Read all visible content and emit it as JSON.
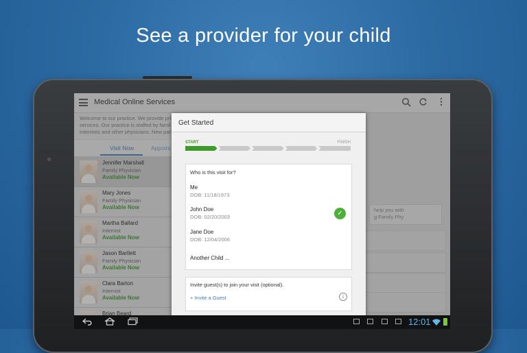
{
  "headline": "See a provider for your child",
  "app": {
    "title": "Medical Online Services",
    "intro_line1": "Welcome to our practice. We provide pri",
    "intro_line2": "services. Our practice is staffed by famil",
    "intro_line3": "internists and other physicians. New pat",
    "icons": [
      "menu-icon",
      "search-icon",
      "refresh-icon",
      "overflow-icon"
    ]
  },
  "tabs": {
    "visit_now": "Visit Now",
    "appointments": "Appoint"
  },
  "providers": [
    {
      "name": "Jennifer Marshall",
      "title": "Family Physician",
      "status": "Available Now"
    },
    {
      "name": "Mary Jones",
      "title": "Family Physician",
      "status": "Available Now"
    },
    {
      "name": "Martha Ballard",
      "title": "Internist",
      "status": "Available Now"
    },
    {
      "name": "Jason Bartlett",
      "title": "Family Physician",
      "status": "Available Now"
    },
    {
      "name": "Clara Barton",
      "title": "Internist",
      "status": "Available Now"
    },
    {
      "name": "Brian Beard",
      "title": "",
      "status": ""
    }
  ],
  "background_help": {
    "line1": "help you with",
    "line2": "g Family Phy"
  },
  "dialog": {
    "title": "Get Started",
    "progress_start": "START",
    "progress_finish": "FINISH",
    "progress_steps_total": 5,
    "progress_steps_done": 1,
    "question": "Who is this visit for?",
    "options": [
      {
        "name": "Me",
        "dob": "DOB: 11/18/1973",
        "selected": false
      },
      {
        "name": "John Doe",
        "dob": "DOB: 02/20/2003",
        "selected": true
      },
      {
        "name": "Jane Doe",
        "dob": "DOB: 12/04/2006",
        "selected": false
      }
    ],
    "another_child": "Another Child ...",
    "invite_text": "Invite guest(s) to join your visit (optional).",
    "invite_link": "+ Invite a Guest",
    "check_glyph": "✓",
    "info_glyph": "i"
  },
  "statusbar": {
    "clock": "12:01"
  },
  "colors": {
    "accent_green": "#3d9a2b",
    "link_blue": "#3d7ec2",
    "clock_blue": "#64b5e8"
  }
}
